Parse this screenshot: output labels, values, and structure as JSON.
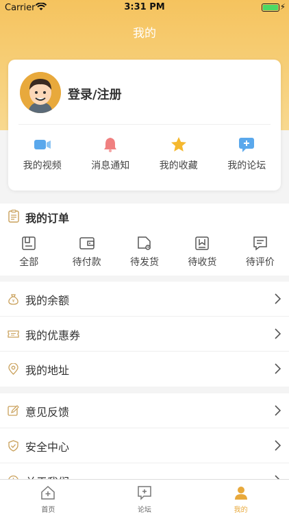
{
  "status_bar": {
    "carrier": "Carrier",
    "time": "3:31 PM"
  },
  "nav": {
    "title": "我的"
  },
  "profile": {
    "login_label": "登录/注册"
  },
  "quick_links": [
    {
      "label": "我的视频",
      "icon": "video-icon",
      "color": "#5aa8ec"
    },
    {
      "label": "消息通知",
      "icon": "bell-icon",
      "color": "#f08080"
    },
    {
      "label": "我的收藏",
      "icon": "star-icon",
      "color": "#f5b82e"
    },
    {
      "label": "我的论坛",
      "icon": "forum-icon",
      "color": "#5aa8ec"
    }
  ],
  "orders": {
    "title": "我的订单",
    "items": [
      {
        "label": "全部",
        "icon": "box-icon"
      },
      {
        "label": "待付款",
        "icon": "wallet-icon"
      },
      {
        "label": "待发货",
        "icon": "truck-icon"
      },
      {
        "label": "待收货",
        "icon": "receive-icon"
      },
      {
        "label": "待评价",
        "icon": "comment-icon"
      }
    ]
  },
  "menu_group_1": [
    {
      "label": "我的余额",
      "icon": "money-bag-icon"
    },
    {
      "label": "我的优惠券",
      "icon": "coupon-icon"
    },
    {
      "label": "我的地址",
      "icon": "location-icon"
    }
  ],
  "menu_group_2": [
    {
      "label": "意见反馈",
      "icon": "edit-icon"
    },
    {
      "label": "安全中心",
      "icon": "shield-icon"
    },
    {
      "label": "关于我们",
      "icon": "info-icon"
    }
  ],
  "tabbar": [
    {
      "label": "首页",
      "icon": "home-icon",
      "active": false
    },
    {
      "label": "论坛",
      "icon": "forum-tab-icon",
      "active": false
    },
    {
      "label": "我的",
      "icon": "user-icon",
      "active": true
    }
  ],
  "colors": {
    "accent": "#e8a93c",
    "hero_top": "#f5c35e",
    "hero_bottom": "#f8d98f"
  }
}
